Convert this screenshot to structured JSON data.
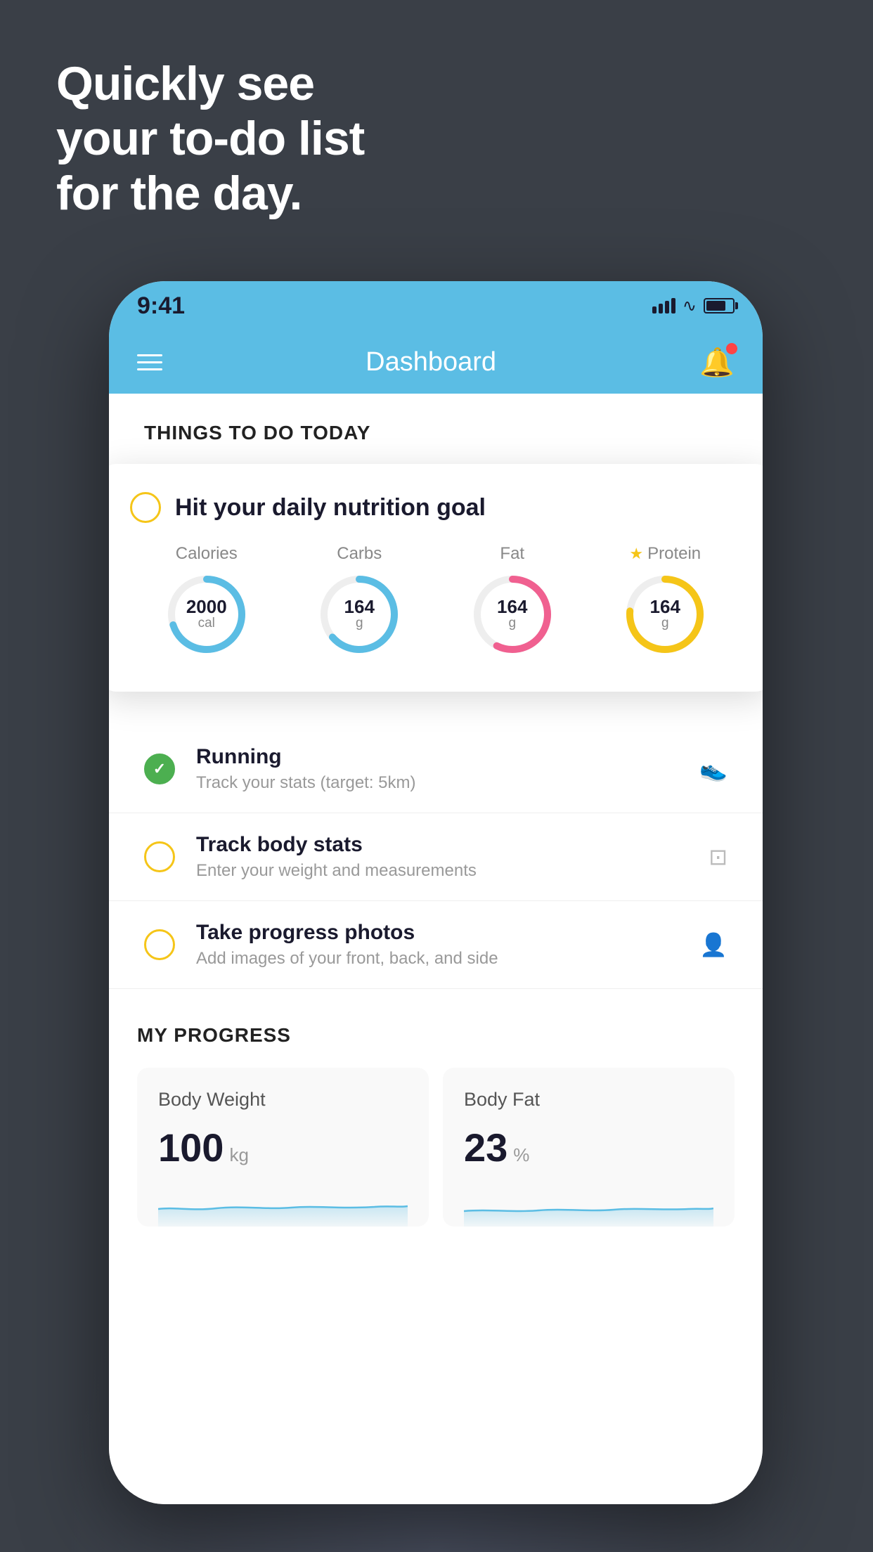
{
  "hero": {
    "line1": "Quickly see",
    "line2": "your to-do list",
    "line3": "for the day."
  },
  "status_bar": {
    "time": "9:41"
  },
  "header": {
    "title": "Dashboard"
  },
  "things_to_do": {
    "section_label": "THINGS TO DO TODAY",
    "floating_card": {
      "title": "Hit your daily nutrition goal",
      "calories": {
        "label": "Calories",
        "value": "2000",
        "unit": "cal"
      },
      "carbs": {
        "label": "Carbs",
        "value": "164",
        "unit": "g"
      },
      "fat": {
        "label": "Fat",
        "value": "164",
        "unit": "g"
      },
      "protein": {
        "label": "Protein",
        "value": "164",
        "unit": "g"
      }
    },
    "items": [
      {
        "title": "Running",
        "subtitle": "Track your stats (target: 5km)",
        "status": "green",
        "icon": "🏃"
      },
      {
        "title": "Track body stats",
        "subtitle": "Enter your weight and measurements",
        "status": "yellow",
        "icon": "⚖"
      },
      {
        "title": "Take progress photos",
        "subtitle": "Add images of your front, back, and side",
        "status": "yellow",
        "icon": "👤"
      }
    ]
  },
  "my_progress": {
    "section_label": "MY PROGRESS",
    "body_weight": {
      "label": "Body Weight",
      "value": "100",
      "unit": "kg"
    },
    "body_fat": {
      "label": "Body Fat",
      "value": "23",
      "unit": "%"
    }
  }
}
